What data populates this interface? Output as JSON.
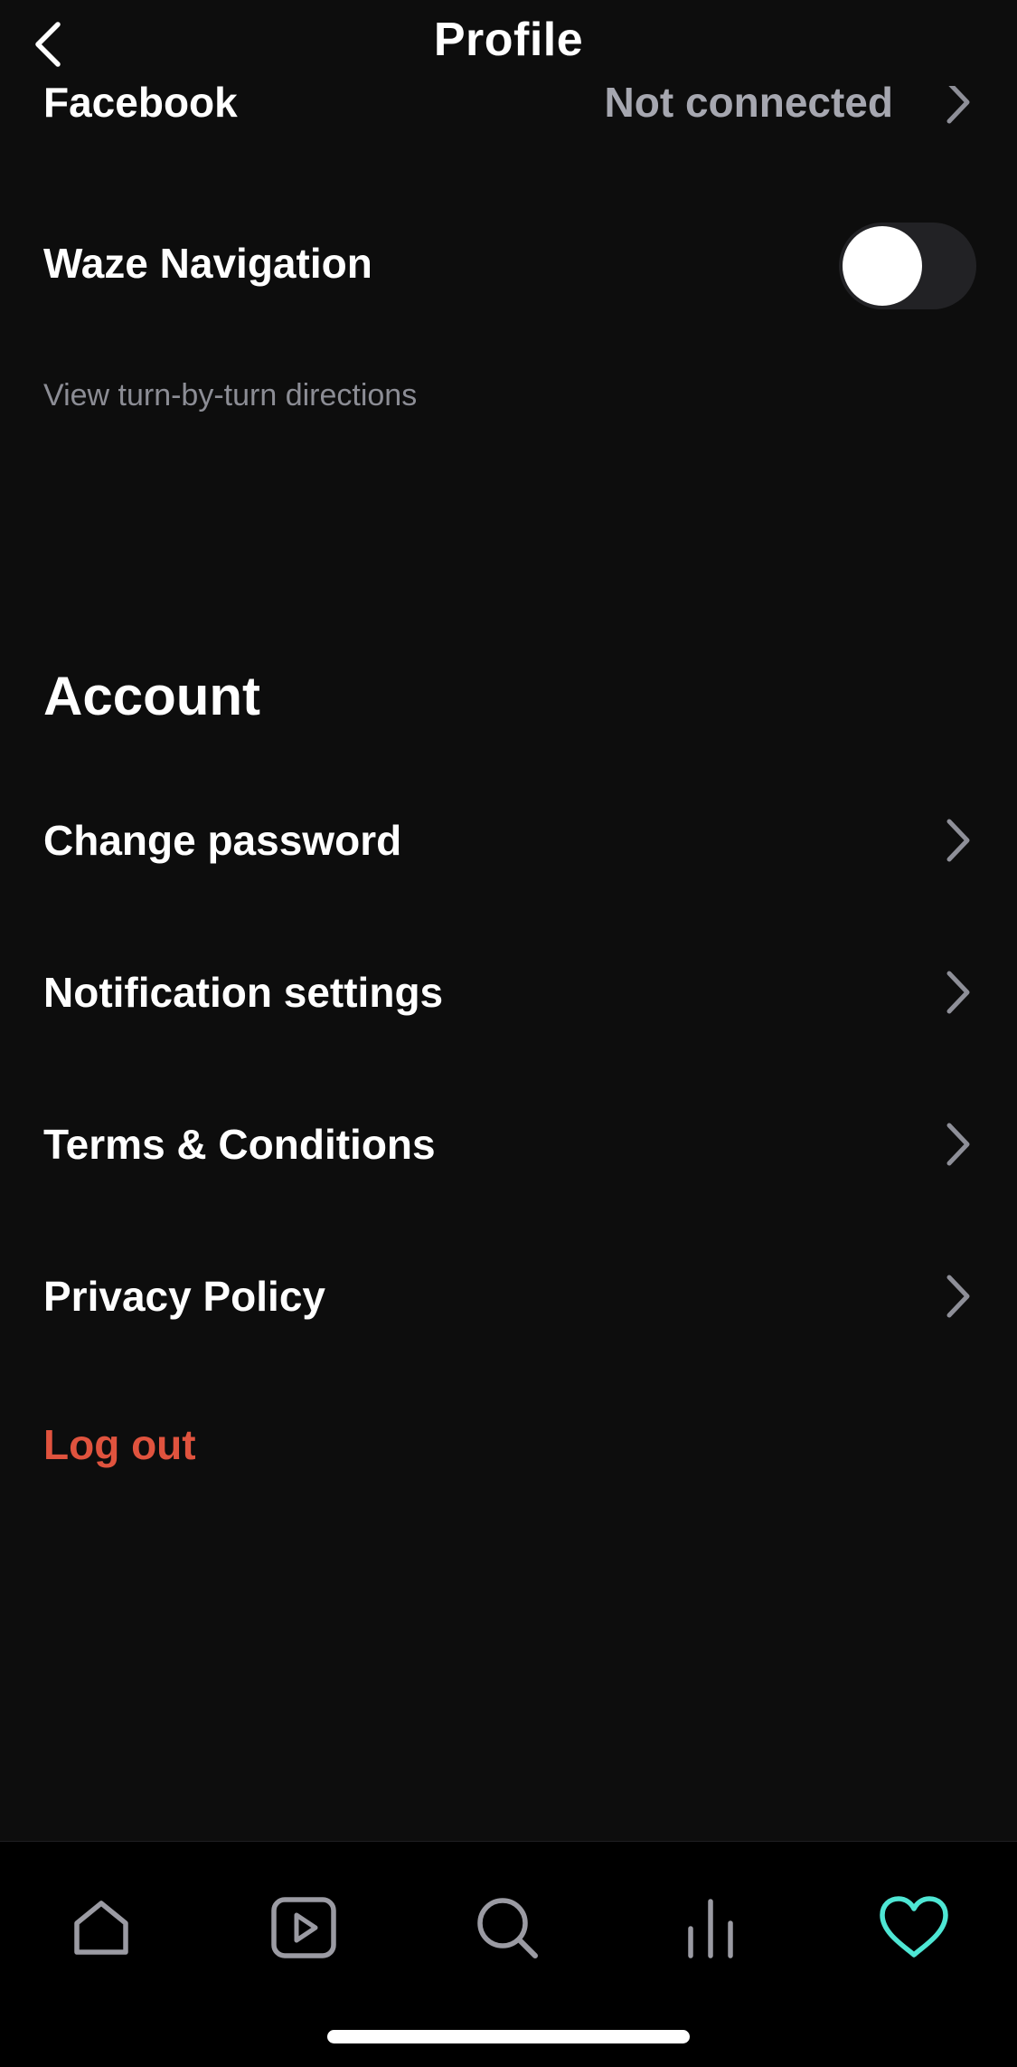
{
  "header": {
    "title": "Profile",
    "back_icon": "chevron-left-icon"
  },
  "connections": {
    "facebook": {
      "label": "Facebook",
      "status": "Not connected"
    },
    "waze": {
      "label": "Waze Navigation",
      "toggle_on": false,
      "helper": "View turn-by-turn directions"
    }
  },
  "account": {
    "title": "Account",
    "items": [
      {
        "label": "Change password"
      },
      {
        "label": "Notification settings"
      },
      {
        "label": "Terms & Conditions"
      },
      {
        "label": "Privacy Policy"
      }
    ],
    "logout_label": "Log out"
  },
  "tabbar": {
    "items": [
      {
        "icon": "home-icon",
        "active": false
      },
      {
        "icon": "play-icon",
        "active": false
      },
      {
        "icon": "search-icon",
        "active": false
      },
      {
        "icon": "stats-icon",
        "active": false
      },
      {
        "icon": "heart-icon",
        "active": true
      }
    ]
  },
  "colors": {
    "background": "#0d0d0d",
    "text": "#ffffff",
    "muted": "#a6a7b0",
    "logout": "#e0533e",
    "active_tab": "#4ee6d4",
    "inactive_tab": "#9b9ba3"
  }
}
